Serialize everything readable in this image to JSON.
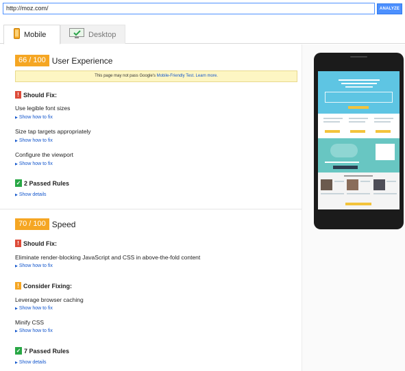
{
  "url": "http://moz.com/",
  "analyze_label": "ANALYZE",
  "tabs": {
    "mobile": "Mobile",
    "desktop": "Desktop"
  },
  "ux": {
    "score": "66 / 100",
    "title": "User Experience",
    "notice_text": "This page may not pass Google's ",
    "notice_link": "Mobile-Friendly Test.",
    "notice_learn": "Learn more.",
    "should_fix": "Should Fix:",
    "rules": [
      "Use legible font sizes",
      "Size tap targets appropriately",
      "Configure the viewport"
    ],
    "show_how": "Show how to fix",
    "passed": "2 Passed Rules",
    "show_details": "Show details"
  },
  "speed": {
    "score": "70 / 100",
    "title": "Speed",
    "should_fix": "Should Fix:",
    "fix_rules": [
      "Eliminate render-blocking JavaScript and CSS in above-the-fold content"
    ],
    "consider": "Consider Fixing:",
    "consider_rules": [
      "Leverage browser caching",
      "Minify CSS"
    ],
    "show_how": "Show how to fix",
    "passed": "7 Passed Rules",
    "show_details": "Show details"
  },
  "colors": {
    "accent": "#4d90fe",
    "score_badge": "#f5a623",
    "should_fix": "#dd4b39",
    "passed": "#28a745",
    "link": "#1155cc"
  },
  "icons": {
    "mobile_tab": "phone-icon",
    "desktop_tab": "monitor-icon"
  }
}
